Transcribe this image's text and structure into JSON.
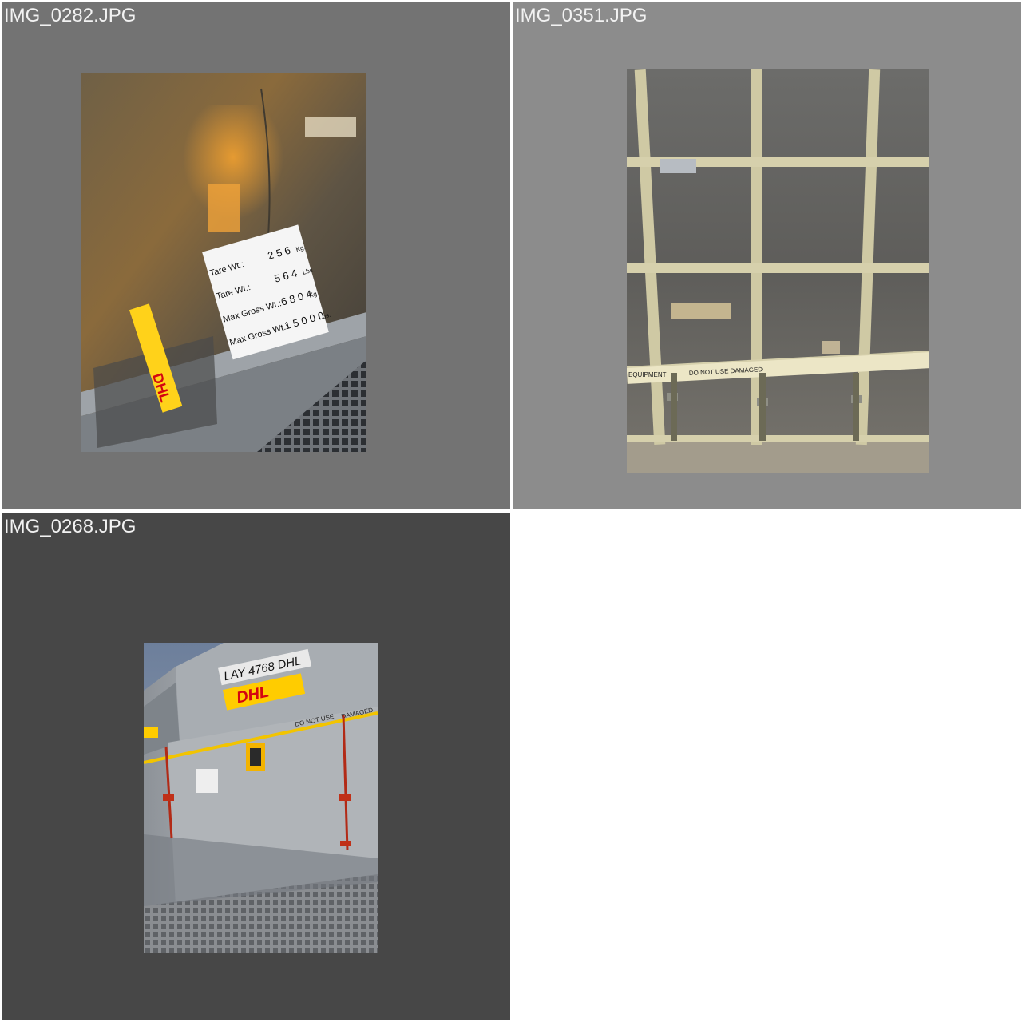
{
  "gallery": {
    "items": [
      {
        "filename": "IMG_0282.JPG",
        "label_lines": [
          {
            "name": "Tare Wt.:",
            "value": "2 5 6",
            "unit": "Kg."
          },
          {
            "name": "Tare Wt.:",
            "value": "5 6 4",
            "unit": "Lbs."
          },
          {
            "name": "Max Gross Wt.:",
            "value": "6 8 0 4",
            "unit": "Kg."
          },
          {
            "name": "Max Gross Wt.:",
            "value": "1 5 0 0 0",
            "unit": "Lbs."
          }
        ],
        "tape_text": "DHL"
      },
      {
        "filename": "IMG_0351.JPG",
        "strap_text_1": "EQUIPMENT",
        "strap_text_2": "DO NOT USE DAMAGED"
      },
      {
        "filename": "IMG_0268.JPG",
        "container_id": "LAY 4768 DHL",
        "brand": "DHL",
        "tape_text": "DO NOT USE",
        "tape_text_2": "DAMAGED"
      }
    ]
  },
  "colors": {
    "tile_1_bg": "#737373",
    "tile_2_bg": "#8c8c8c",
    "tile_3_bg": "#474747",
    "caption": "#f2f2f2",
    "dhl_yellow": "#ffcc00",
    "dhl_red": "#d40511"
  }
}
